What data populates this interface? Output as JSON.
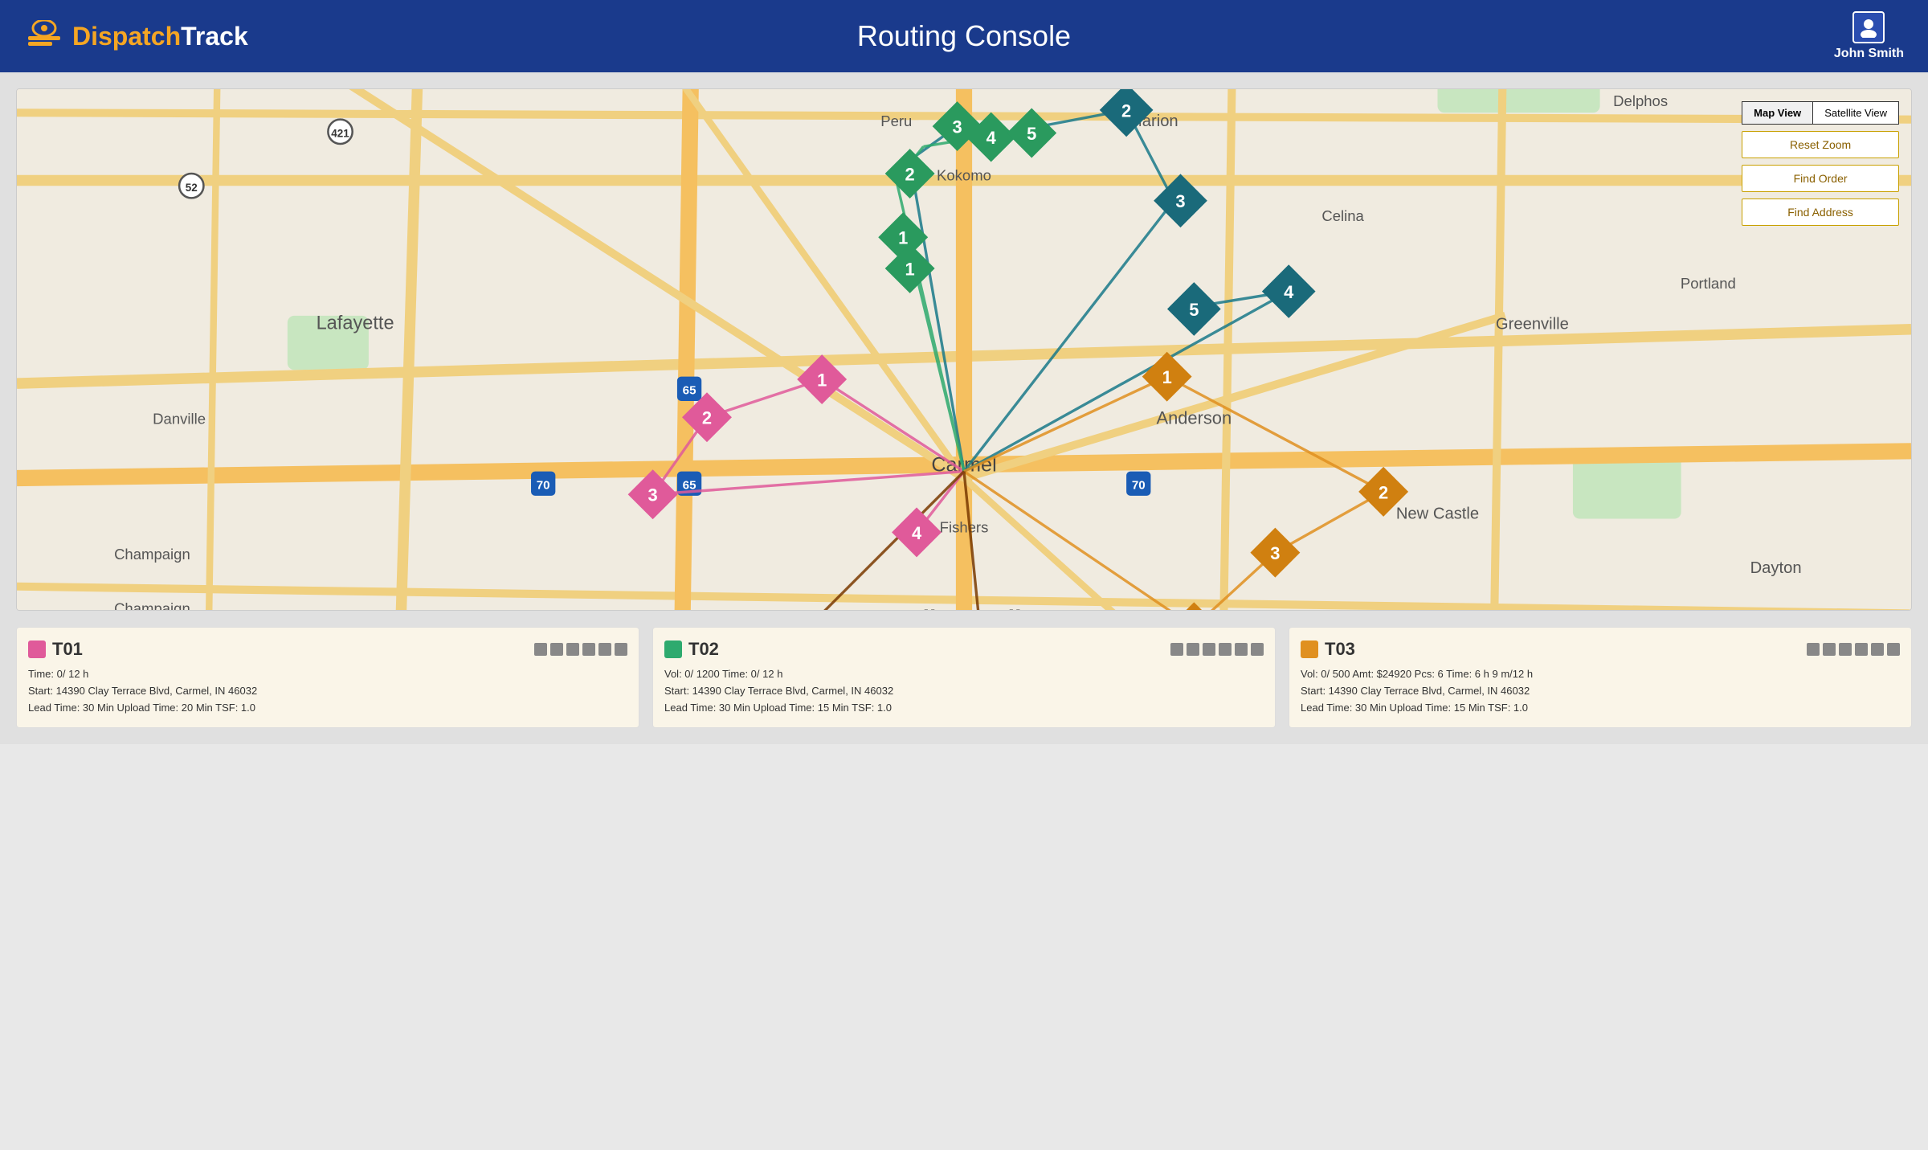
{
  "header": {
    "logo_text": "Dispatch Track",
    "logo_span": "Dispatch",
    "title": "Routing Console",
    "user_name": "John Smith"
  },
  "map": {
    "view_buttons": [
      {
        "label": "Map View",
        "active": true
      },
      {
        "label": "Satellite View",
        "active": false
      }
    ],
    "action_buttons": [
      {
        "label": "Reset Zoom",
        "id": "reset-zoom"
      },
      {
        "label": "Find Order",
        "id": "find-order"
      },
      {
        "label": "Find Address",
        "id": "find-address"
      }
    ]
  },
  "routes": [
    {
      "id": "T01",
      "color": "#e05a9a",
      "info_line1": "Time: 0/ 12 h",
      "info_line2": "Start: 14390 Clay Terrace Blvd, Carmel, IN 46032",
      "info_line3": "Lead Time: 30 Min  Upload Time: 20 Min TSF: 1.0"
    },
    {
      "id": "T02",
      "color": "#2eaa6e",
      "info_line1": "Vol: 0/ 1200  Time: 0/ 12 h",
      "info_line2": "Start: 14390 Clay Terrace Blvd, Carmel, IN 46032",
      "info_line3": "Lead Time: 30 Min  Upload Time: 15 Min TSF: 1.0"
    },
    {
      "id": "T03",
      "color": "#e09020",
      "info_line1": "Vol: 0/ 500  Amt: $24920  Pcs: 6  Time: 6 h 9 m/12 h",
      "info_line2": "Start: 14390 Clay Terrace Blvd, Carmel, IN 46032",
      "info_line3": "Lead Time: 30 Min  Upload Time: 15 Min TSF: 1.0"
    }
  ]
}
